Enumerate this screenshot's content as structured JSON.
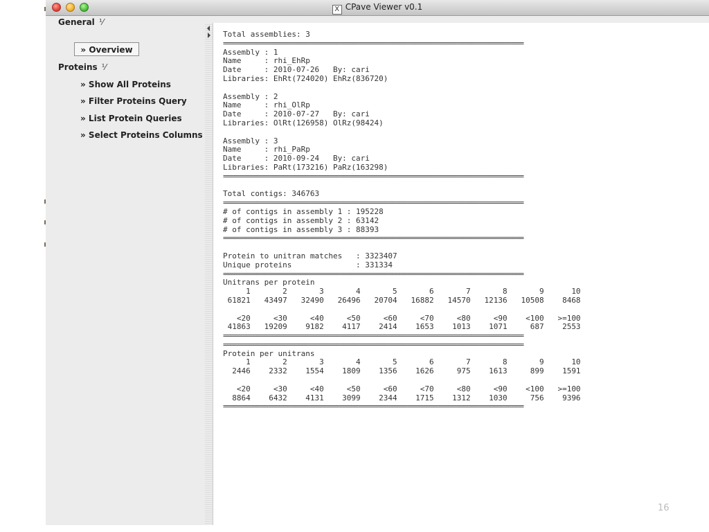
{
  "window": {
    "title": "CPave Viewer v0.1"
  },
  "sidebar": {
    "general": {
      "label": "General",
      "expand_glyph": "⅟"
    },
    "overview": "» Overview",
    "proteins": {
      "label": "Proteins",
      "expand_glyph": "⅟"
    },
    "items": [
      "» Show All Proteins",
      "» Filter Proteins Query",
      "» List Protein Queries",
      "» Select Proteins Columns"
    ]
  },
  "report": {
    "total_assemblies": "Total assemblies: 3",
    "separator": "================================================================================",
    "assemblies": [
      {
        "assembly": "Assembly : 1",
        "name": "Name     : rhi_EhRp",
        "date": "Date     : 2010-07-26   By: cari",
        "libraries": "Libraries: EhRt(724020) EhRz(836720)"
      },
      {
        "assembly": "Assembly : 2",
        "name": "Name     : rhi_OlRp",
        "date": "Date     : 2010-07-27   By: cari",
        "libraries": "Libraries: OlRt(126958) OlRz(98424)"
      },
      {
        "assembly": "Assembly : 3",
        "name": "Name     : rhi_PaRp",
        "date": "Date     : 2010-09-24   By: cari",
        "libraries": "Libraries: PaRt(173216) PaRz(163298)"
      }
    ],
    "total_contigs": "Total contigs: 346763",
    "contigs": [
      "# of contigs in assembly 1 : 195228",
      "# of contigs in assembly 2 : 63142",
      "# of contigs in assembly 3 : 88393"
    ],
    "protein_matches": "Protein to unitran matches   : 3323407",
    "unique_proteins": "Unique proteins              : 331334",
    "unitrans_per_protein": {
      "heading": "Unitrans per protein",
      "h1": "     1       2       3       4       5       6       7       8       9      10",
      "v1": " 61821   43497   32490   26496   20704   16882   14570   12136   10508    8468",
      "h2": "   <20     <30     <40     <50     <60     <70     <80     <90    <100   >=100",
      "v2": " 41863   19209    9182    4117    2414    1653    1013    1071     687    2553"
    },
    "protein_per_unitrans": {
      "heading": "Protein per unitrans",
      "h1": "     1       2       3       4       5       6       7       8       9      10",
      "v1": "  2446    2332    1554    1809    1356    1626     975    1613     899    1591",
      "h2": "   <20     <30     <40     <50     <60     <70     <80     <90    <100   >=100",
      "v2": "  8864    6432    4131    3099    2344    1715    1312    1030     756    9396"
    }
  },
  "page_number": "16"
}
